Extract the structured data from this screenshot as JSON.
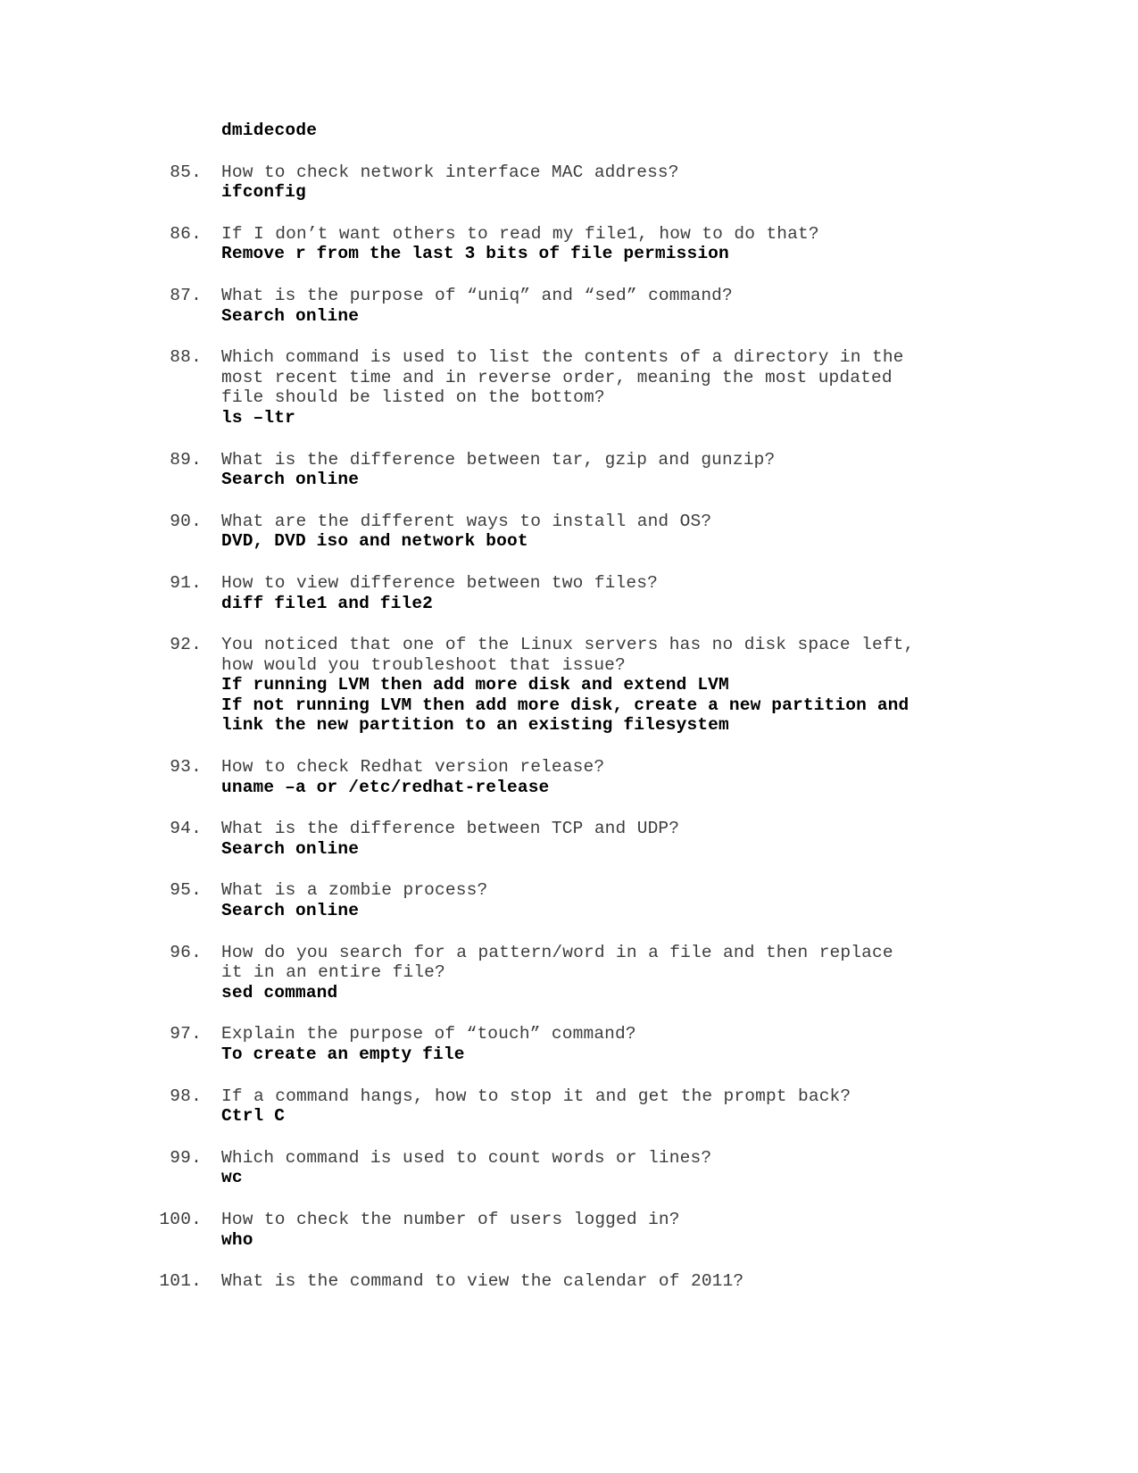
{
  "document": {
    "type": "linux-interview-questions",
    "orphan_answer": "dmidecode",
    "items": [
      {
        "number": "85.",
        "question": "How to check network interface MAC address?",
        "answers": [
          "ifconfig"
        ]
      },
      {
        "number": "86.",
        "question": "If I don’t want others to read my file1, how to do that?",
        "answers": [
          "Remove r from the last 3 bits of file permission"
        ]
      },
      {
        "number": "87.",
        "question": "What is the purpose of “uniq” and “sed” command?",
        "answers": [
          "Search online"
        ]
      },
      {
        "number": "88.",
        "question": "Which command is used to list the contents of a directory in the\nmost recent time and in reverse order, meaning the most updated\nfile should be listed on the bottom?",
        "answers": [
          "ls –ltr"
        ]
      },
      {
        "number": "89.",
        "question": "What is the difference between tar, gzip and gunzip?",
        "answers": [
          "Search online"
        ]
      },
      {
        "number": "90.",
        "question": "What are the different ways to install and OS?",
        "answers": [
          "DVD, DVD iso and network boot"
        ]
      },
      {
        "number": "91.",
        "question": "How to view difference between two files?",
        "answers": [
          "diff file1 and file2"
        ]
      },
      {
        "number": "92.",
        "question": "You noticed that one of the Linux servers has no disk space left,\nhow would you troubleshoot that issue?",
        "answers": [
          "If running LVM then add more disk and extend LVM",
          "If not running LVM then add more disk, create a new partition and\nlink the new partition to an existing filesystem"
        ]
      },
      {
        "number": "93.",
        "question": "How to check Redhat version release?",
        "answers": [
          "uname –a or /etc/redhat-release"
        ]
      },
      {
        "number": "94.",
        "question": "What is the difference between TCP and UDP?",
        "answers": [
          "Search online"
        ]
      },
      {
        "number": "95.",
        "question": "What is a zombie process?",
        "answers": [
          "Search online"
        ]
      },
      {
        "number": "96.",
        "question": "How do you search for a pattern/word in a file and then replace\nit in an entire file?",
        "answers": [
          "sed command"
        ]
      },
      {
        "number": "97.",
        "question": "Explain the purpose of “touch” command?",
        "answers": [
          "To create an empty file"
        ]
      },
      {
        "number": "98.",
        "question": "If a command hangs, how to stop it and get the prompt back?",
        "answers": [
          "Ctrl C"
        ]
      },
      {
        "number": "99.",
        "question": "Which command is used to count words or lines?",
        "answers": [
          "wc"
        ]
      },
      {
        "number": "100.",
        "question": "How to check the number of users logged in?",
        "answers": [
          "who"
        ]
      },
      {
        "number": "101.",
        "question": "What is the command to view the calendar of 2011?",
        "answers": []
      }
    ]
  }
}
